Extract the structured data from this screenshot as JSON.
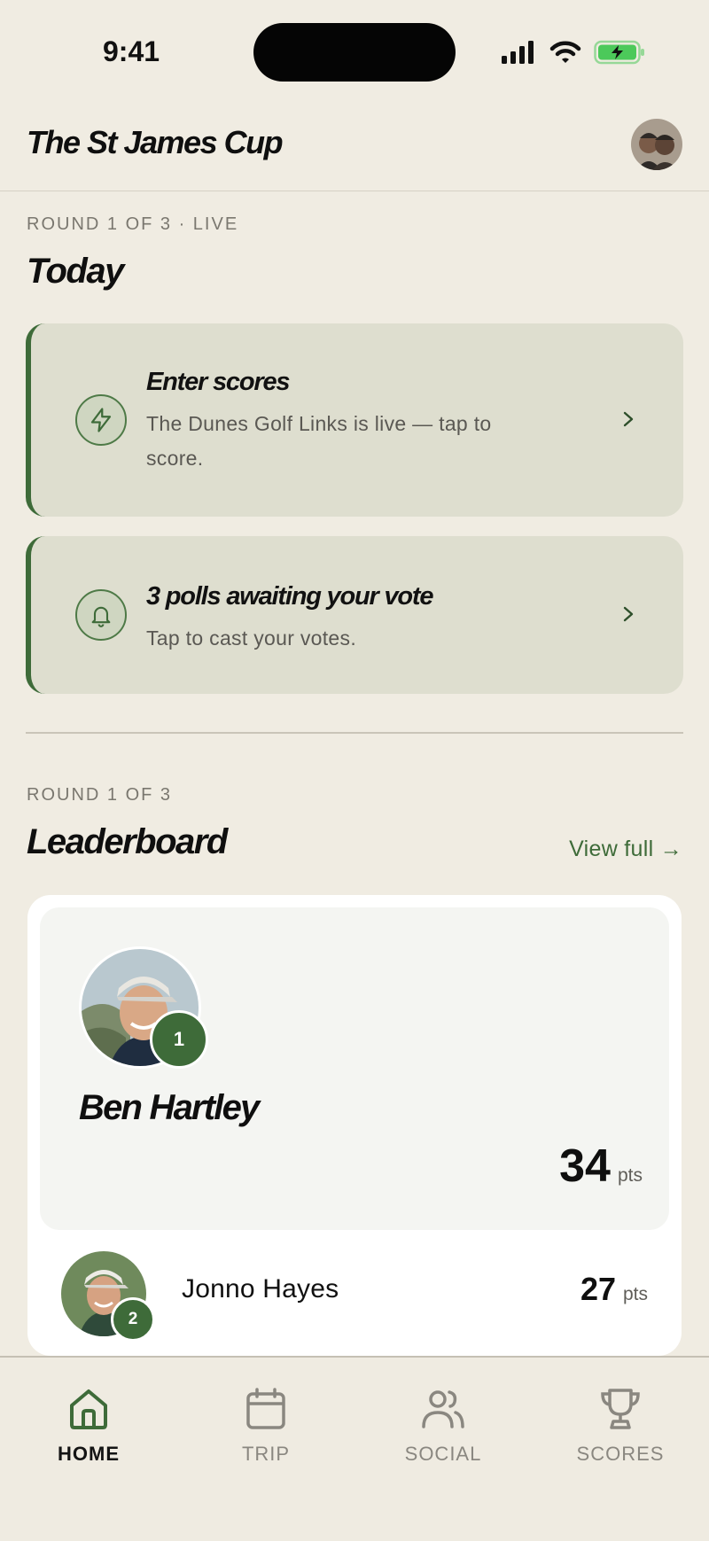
{
  "status_bar": {
    "time": "9:41"
  },
  "header": {
    "title": "The St James Cup"
  },
  "today": {
    "eyebrow": "ROUND 1 OF 3 · LIVE",
    "title": "Today",
    "cards": [
      {
        "title": "Enter scores",
        "subtitle": "The Dunes Golf Links is live — tap to score.",
        "icon": "lightning-icon"
      },
      {
        "title": "3 polls awaiting your vote",
        "subtitle": "Tap to cast your votes.",
        "icon": "bell-icon"
      }
    ]
  },
  "leaderboard": {
    "eyebrow": "ROUND 1 OF 3",
    "title": "Leaderboard",
    "view_full": "View full →",
    "entries": [
      {
        "rank": "1",
        "name": "Ben Hartley",
        "points": "34",
        "unit": "pts"
      },
      {
        "rank": "2",
        "name": "Jonno Hayes",
        "points": "27",
        "unit": "pts"
      }
    ]
  },
  "tabs": [
    {
      "label": "HOME",
      "icon": "home-icon",
      "active": true
    },
    {
      "label": "TRIP",
      "icon": "calendar-icon",
      "active": false
    },
    {
      "label": "SOCIAL",
      "icon": "people-icon",
      "active": false
    },
    {
      "label": "SCORES",
      "icon": "trophy-icon",
      "active": false
    }
  ],
  "colors": {
    "background": "#F0ECE2",
    "accent": "#3E6B39",
    "card": "#DEDECF",
    "battery": "#4CC95A"
  }
}
